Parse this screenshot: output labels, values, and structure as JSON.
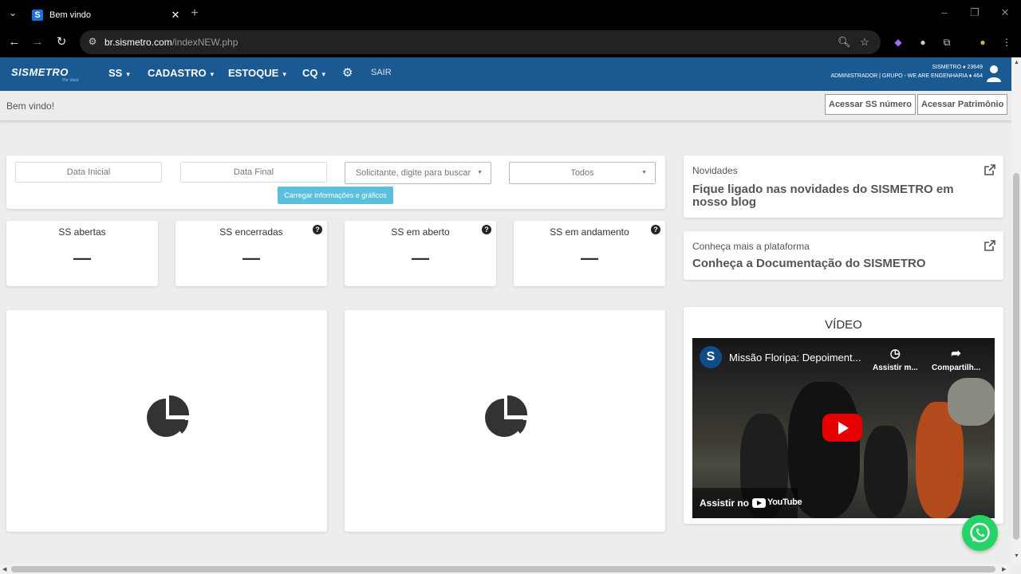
{
  "browser": {
    "tab_title": "Bem vindo",
    "favicon_letter": "S",
    "url_host": "br.sismetro.com",
    "url_path": "/indexNEW.php"
  },
  "header": {
    "logo": "SISMETRO",
    "logo_sub": "Por Você",
    "menu": [
      {
        "label": "SS"
      },
      {
        "label": "CADASTRO"
      },
      {
        "label": "ESTOQUE"
      },
      {
        "label": "CQ"
      }
    ],
    "logout": "SAIR",
    "account_line1": "SISMETRO ♦ 23649",
    "account_line2": "ADMINISTRADOR | GRUPO - WE ARE ENGENHARIA ♦ 464"
  },
  "welcome_bar": {
    "text": "Bem vindo!",
    "btn_ss": "Acessar SS número",
    "btn_patrimonio": "Acessar Patrimônio"
  },
  "filters": {
    "date_start": "Data Inicial",
    "date_end": "Data Final",
    "requester": "Solicitante, digite para buscar",
    "status": "Todos",
    "load_button": "Carregar informações e gráficos"
  },
  "stats": [
    {
      "title": "SS abertas",
      "value": "—",
      "help": false
    },
    {
      "title": "SS encerradas",
      "value": "—",
      "help": true
    },
    {
      "title": "SS em aberto",
      "value": "—",
      "help": true
    },
    {
      "title": "SS em andamento",
      "value": "—",
      "help": true
    }
  ],
  "side": {
    "news_kicker": "Novidades",
    "news_title": "Fique ligado nas novidades do SISMETRO em nosso blog",
    "docs_kicker": "Conheça mais a plataforma",
    "docs_title": "Conheça a Documentação do SISMETRO",
    "video_heading": "VÍDEO",
    "video_title": "Missão Floripa: Depoiment...",
    "video_watch_later": "Assistir m...",
    "video_share": "Compartilh...",
    "video_watch_on": "Assistir no",
    "video_brand": "YouTube"
  },
  "colors": {
    "header_bg": "#1b5993",
    "load_button": "#5bc0de",
    "whatsapp": "#25d366"
  }
}
